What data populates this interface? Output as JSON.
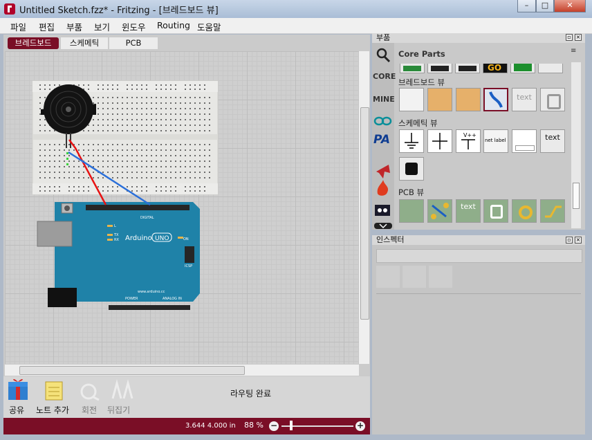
{
  "window": {
    "title": "Untitled Sketch.fzz* - Fritzing - [브레드보드 뷰]",
    "min": "–",
    "max": "□",
    "close": "✕"
  },
  "menu": [
    "파일",
    "편집",
    "부품",
    "보기",
    "윈도우",
    "Routing",
    "도움말"
  ],
  "view_tabs": [
    "브레드보드",
    "스케메틱",
    "PCB"
  ],
  "canvas": {
    "arduino_label": "Arduino",
    "uno_label": "UNO",
    "digital_label": "DIGITAL",
    "power_label": "POWER",
    "analog_label": "ANALOG IN",
    "icsp_label": "ICSP",
    "on_label": "ON",
    "url_label": "www.arduino.cc",
    "tx_label": "TX",
    "rx_label": "RX",
    "l_label": "L"
  },
  "toolbar": {
    "share": "공유",
    "add_note": "노트 추가",
    "rotate": "회전",
    "flip": "뒤집기",
    "routing_status": "라우팅 완료"
  },
  "status": {
    "coords": "3.644 4.000 in",
    "zoom": "88 %",
    "zoom_fill": 0.12
  },
  "parts_panel": {
    "header": "부품",
    "bin_title": "Core Parts",
    "side_icons": [
      "search-icon",
      "CORE",
      "MINE",
      "arduino-icon",
      "PA",
      "seeed-icon",
      "sparkfun-icon",
      "monster-icon"
    ],
    "section_breadboard": "브레드보드 뷰",
    "section_schematic": "스케메틱 뷰",
    "section_pcb": "PCB 뷰",
    "part_text": "text",
    "part_netlabel": "net label",
    "part_vcc": "V++",
    "part_go": "GO"
  },
  "inspector": {
    "header": "인스펙터"
  },
  "colors": {
    "accent": "#7a0e26",
    "arduino": "#1f82a8"
  }
}
